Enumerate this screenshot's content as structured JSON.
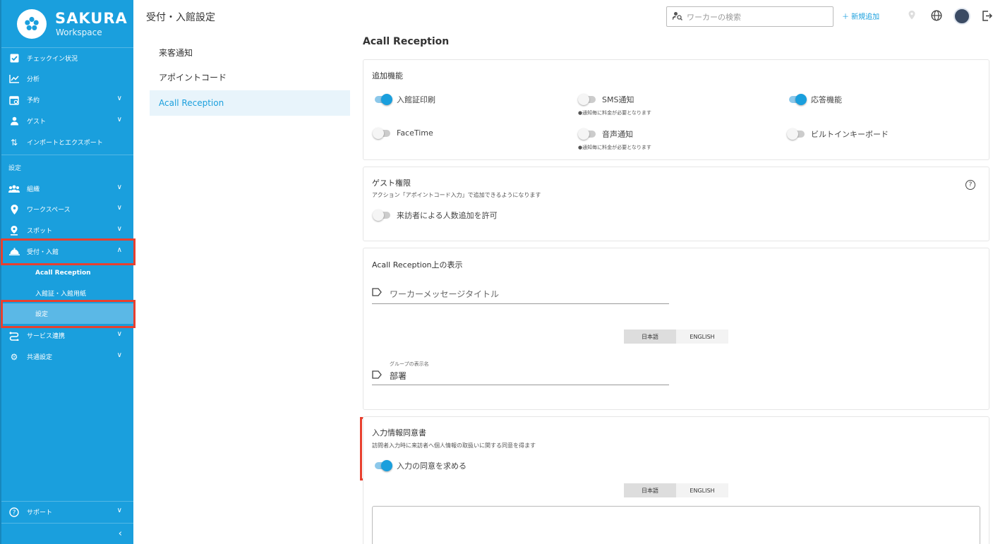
{
  "brand": {
    "name": "SAKURA",
    "sub": "Workspace"
  },
  "sidebar": {
    "items": [
      {
        "label": "チェックイン状況",
        "icon": "checkbox-icon"
      },
      {
        "label": "分析",
        "icon": "chart-icon"
      },
      {
        "label": "予約",
        "icon": "calendar-icon"
      },
      {
        "label": "ゲスト",
        "icon": "guest-icon"
      },
      {
        "label": "インポートとエクスポート",
        "icon": "import-export-icon"
      }
    ],
    "section_label": "設定",
    "settings_items": [
      {
        "label": "組織",
        "icon": "people-icon"
      },
      {
        "label": "ワークスペース",
        "icon": "pin-icon"
      },
      {
        "label": "スポット",
        "icon": "spot-icon"
      },
      {
        "label": "受付・入館",
        "icon": "reception-bell-icon"
      }
    ],
    "sub_items": [
      {
        "label": "Acall Reception"
      },
      {
        "label": "入館証・入館用紙"
      },
      {
        "label": "設定"
      }
    ],
    "more_items": [
      {
        "label": "サービス連携",
        "icon": "integration-icon"
      },
      {
        "label": "共通設定",
        "icon": "cogs-icon"
      }
    ],
    "support_label": "サポート"
  },
  "header": {
    "title": "受付・入館設定",
    "search_placeholder": "ワーカーの検索",
    "new_label": "＋ 新規追加"
  },
  "submenu": {
    "items": [
      {
        "label": "来客通知"
      },
      {
        "label": "アポイントコード"
      },
      {
        "label": "Acall Reception"
      }
    ]
  },
  "main": {
    "title": "Acall Reception",
    "additional": {
      "title": "追加機能",
      "toggles": [
        {
          "label": "入館証印刷",
          "on": true
        },
        {
          "label": "SMS通知",
          "on": false,
          "note": "●通知毎に料金が必要となります"
        },
        {
          "label": "応答機能",
          "on": true
        },
        {
          "label": "FaceTime",
          "on": false
        },
        {
          "label": "音声通知",
          "on": false,
          "note": "●通知毎に料金が必要となります"
        },
        {
          "label": "ビルトインキーボード",
          "on": false
        }
      ]
    },
    "guest": {
      "title": "ゲスト権限",
      "desc": "アクション「アポイントコード入力」で追加できるようになります",
      "toggle_label": "来訪者による人数追加を許可",
      "help": "?"
    },
    "display": {
      "title": "Acall Reception上の表示",
      "worker_placeholder": "ワーカーメッセージタイトル",
      "lang_ja": "日本語",
      "lang_en": "ENGLISH",
      "group_label": "グループの表示名",
      "group_value": "部署"
    },
    "consent": {
      "title": "入力情報同意書",
      "desc": "訪問者入力時に来訪者へ個人情報の取扱いに関する同意を得ます",
      "toggle_label": "入力の同意を求める",
      "lang_ja": "日本語",
      "lang_en": "ENGLISH"
    }
  }
}
